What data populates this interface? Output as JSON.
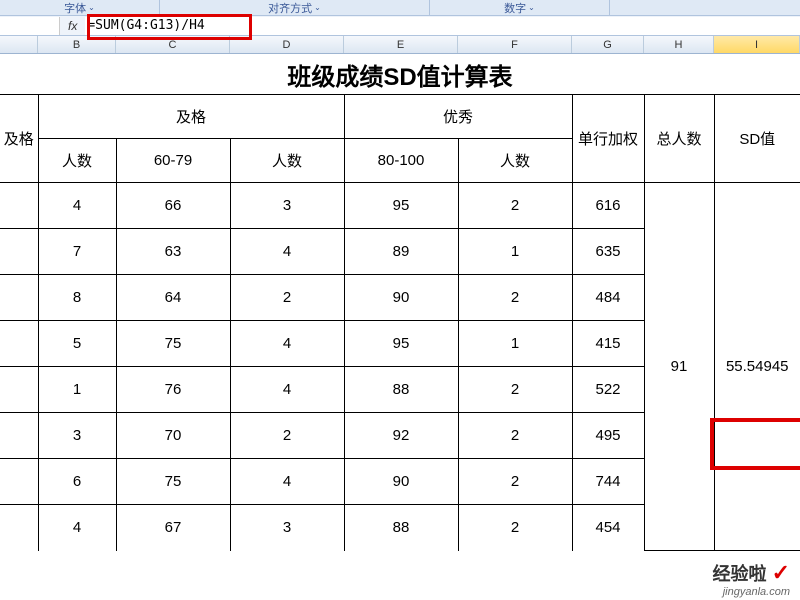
{
  "ribbon": {
    "font_label": "字体",
    "align_label": "对齐方式",
    "number_label": "数字"
  },
  "formula_bar": {
    "fx": "fx",
    "formula": "=SUM(G4:G13)/H4"
  },
  "columns": {
    "b": "B",
    "c": "C",
    "d": "D",
    "e": "E",
    "f": "F",
    "g": "G",
    "h": "H",
    "i": "I"
  },
  "title": "班级成绩SD值计算表",
  "headers": {
    "col_a_partial": "及格",
    "jige": "及格",
    "youxiu": "优秀",
    "danhang": "单行加权",
    "zongren": "总人数",
    "sdzhi": "SD值",
    "renshu": "人数",
    "range1": "60-79",
    "range2": "80-100"
  },
  "rows": [
    {
      "b": "4",
      "c": "66",
      "d": "3",
      "e": "95",
      "f": "2",
      "g": "616"
    },
    {
      "b": "7",
      "c": "63",
      "d": "4",
      "e": "89",
      "f": "1",
      "g": "635"
    },
    {
      "b": "8",
      "c": "64",
      "d": "2",
      "e": "90",
      "f": "2",
      "g": "484"
    },
    {
      "b": "5",
      "c": "75",
      "d": "4",
      "e": "95",
      "f": "1",
      "g": "415"
    },
    {
      "b": "1",
      "c": "76",
      "d": "4",
      "e": "88",
      "f": "2",
      "g": "522"
    },
    {
      "b": "3",
      "c": "70",
      "d": "2",
      "e": "92",
      "f": "2",
      "g": "495"
    },
    {
      "b": "6",
      "c": "75",
      "d": "4",
      "e": "90",
      "f": "2",
      "g": "744"
    },
    {
      "b": "4",
      "c": "67",
      "d": "3",
      "e": "88",
      "f": "2",
      "g": "454"
    }
  ],
  "totals": {
    "h": "91",
    "i": "55.54945"
  },
  "watermark": {
    "main": "经验啦",
    "check": "✓",
    "sub": "jingyanla.com"
  }
}
